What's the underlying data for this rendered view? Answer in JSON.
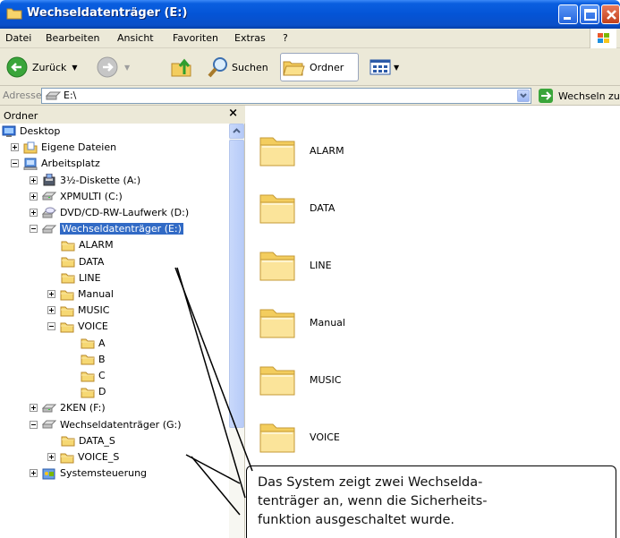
{
  "window": {
    "title": "Wechseldatenträger (E:)"
  },
  "menu": [
    "Datei",
    "Bearbeiten",
    "Ansicht",
    "Favoriten",
    "Extras",
    "?"
  ],
  "toolbar": {
    "back": "Zurück",
    "search": "Suchen",
    "folders": "Ordner"
  },
  "address": {
    "label": "Adresse",
    "value": "E:\\",
    "go": "Wechseln zu"
  },
  "folder_pane": {
    "header": "Ordner",
    "close": "×",
    "tree": [
      {
        "label": "Desktop",
        "icon": "desktop-icon"
      },
      {
        "label": "Eigene Dateien",
        "icon": "documents-icon",
        "expander": "plus"
      },
      {
        "label": "Arbeitsplatz",
        "icon": "computer-icon",
        "expander": "minus"
      },
      {
        "label": "3½-Diskette (A:)",
        "icon": "floppy-icon",
        "expander": "plus"
      },
      {
        "label": "XPMULTI (C:)",
        "icon": "drive-icon",
        "expander": "plus"
      },
      {
        "label": "DVD/CD-RW-Laufwerk (D:)",
        "icon": "cd-drive-icon",
        "expander": "plus"
      },
      {
        "label": "Wechseldatenträger (E:)",
        "icon": "removable-drive-icon",
        "expander": "minus",
        "selected": true
      },
      {
        "label": "ALARM",
        "icon": "folder-icon"
      },
      {
        "label": "DATA",
        "icon": "folder-icon"
      },
      {
        "label": "LINE",
        "icon": "folder-icon"
      },
      {
        "label": "Manual",
        "icon": "folder-icon",
        "expander": "plus"
      },
      {
        "label": "MUSIC",
        "icon": "folder-icon",
        "expander": "plus"
      },
      {
        "label": "VOICE",
        "icon": "folder-icon",
        "expander": "minus"
      },
      {
        "label": "A",
        "icon": "folder-icon"
      },
      {
        "label": "B",
        "icon": "folder-icon"
      },
      {
        "label": "C",
        "icon": "folder-icon"
      },
      {
        "label": "D",
        "icon": "folder-icon"
      },
      {
        "label": "2KEN (F:)",
        "icon": "drive-icon",
        "expander": "plus"
      },
      {
        "label": "Wechseldatenträger (G:)",
        "icon": "removable-drive-icon",
        "expander": "minus"
      },
      {
        "label": "DATA_S",
        "icon": "folder-icon"
      },
      {
        "label": "VOICE_S",
        "icon": "folder-icon",
        "expander": "plus"
      },
      {
        "label": "Systemsteuerung",
        "icon": "control-panel-icon",
        "expander": "plus"
      }
    ]
  },
  "content": {
    "items": [
      "ALARM",
      "DATA",
      "LINE",
      "Manual",
      "MUSIC",
      "VOICE"
    ]
  },
  "callout": {
    "text": "Das System zeigt zwei Wechselda-\ntenträger an, wenn die Sicherheits-\nfunktion ausgeschaltet wurde."
  }
}
